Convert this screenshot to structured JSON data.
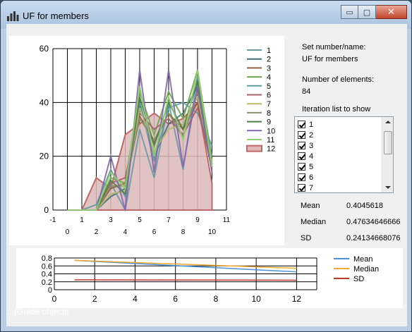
{
  "window": {
    "title": "UF for members",
    "minimize_symbol": "▭",
    "maximize_symbol": "▢",
    "close_symbol": "✕"
  },
  "info": {
    "set_label": "Set number/name:",
    "set_value": "UF for members",
    "elements_label": "Number of elements:",
    "elements_value": "84",
    "iteration_label": "Iteration list to show",
    "iterations": [
      {
        "label": "1",
        "checked": true
      },
      {
        "label": "2",
        "checked": true
      },
      {
        "label": "3",
        "checked": true
      },
      {
        "label": "4",
        "checked": true
      },
      {
        "label": "5",
        "checked": true
      },
      {
        "label": "6",
        "checked": true
      },
      {
        "label": "7",
        "checked": true
      }
    ]
  },
  "stats": {
    "mean_label": "Mean",
    "mean_value": "0.4045618",
    "median_label": "Median",
    "median_value": "0.47634646666",
    "sd_label": "SD",
    "sd_value": "0.24134668076"
  },
  "background_text": "...(Guide objects",
  "chart_data": [
    {
      "type": "line",
      "title": "",
      "xlabel": "",
      "ylabel": "",
      "xlim": [
        -1,
        11
      ],
      "ylim": [
        0,
        60
      ],
      "x_ticks_top": [
        "-1",
        "1",
        "3",
        "5",
        "7",
        "9",
        "11"
      ],
      "x_ticks_bottom": [
        "0",
        "2",
        "4",
        "6",
        "8",
        "10"
      ],
      "y_ticks": [
        "0",
        "20",
        "40",
        "60"
      ],
      "grid": true,
      "legend_position": "right",
      "x": [
        0,
        1,
        2,
        3,
        4,
        5,
        6,
        7,
        8,
        9,
        10
      ],
      "series": [
        {
          "name": "1",
          "color": "#6b9aa6",
          "values": [
            0,
            0,
            0,
            10,
            0,
            30,
            12,
            40,
            15,
            50,
            20
          ]
        },
        {
          "name": "2",
          "color": "#3d6e80",
          "values": [
            0,
            0,
            0,
            5,
            8,
            40,
            20,
            32,
            36,
            46,
            17
          ]
        },
        {
          "name": "3",
          "color": "#8e5f3c",
          "values": [
            0,
            0,
            0,
            8,
            10,
            35,
            25,
            36,
            30,
            40,
            15
          ]
        },
        {
          "name": "4",
          "color": "#6fa84b",
          "values": [
            0,
            0,
            0,
            12,
            10,
            44,
            28,
            44,
            34,
            52,
            18
          ]
        },
        {
          "name": "5",
          "color": "#5c9aa0",
          "values": [
            0,
            0,
            2,
            15,
            5,
            40,
            18,
            38,
            40,
            36,
            24
          ]
        },
        {
          "name": "6",
          "color": "#a8606b",
          "values": [
            0,
            0,
            0,
            10,
            12,
            36,
            30,
            34,
            28,
            38,
            16
          ]
        },
        {
          "name": "7",
          "color": "#b8b86a",
          "values": [
            0,
            0,
            0,
            6,
            7,
            38,
            22,
            30,
            32,
            42,
            18
          ]
        },
        {
          "name": "8",
          "color": "#8c8c68",
          "values": [
            0,
            0,
            0,
            9,
            9,
            34,
            26,
            36,
            27,
            44,
            17
          ]
        },
        {
          "name": "9",
          "color": "#4f7f49",
          "values": [
            0,
            0,
            0,
            11,
            6,
            42,
            24,
            40,
            30,
            48,
            16
          ]
        },
        {
          "name": "10",
          "color": "#8466b0",
          "values": [
            0,
            0,
            0,
            20,
            0,
            52,
            14,
            52,
            16,
            46,
            14
          ]
        },
        {
          "name": "11",
          "color": "#8fcf70",
          "values": [
            0,
            0,
            0,
            14,
            8,
            46,
            20,
            42,
            26,
            52,
            16
          ]
        },
        {
          "name": "12",
          "color": "#c06866",
          "fill": "#dcb8b8",
          "style": "area",
          "values": [
            0,
            0,
            12,
            8,
            28,
            32,
            36,
            32,
            34,
            40,
            10
          ]
        }
      ]
    },
    {
      "type": "line",
      "title": "",
      "xlabel": "",
      "ylabel": "",
      "xlim": [
        0,
        13
      ],
      "ylim": [
        0,
        0.8
      ],
      "x_ticks": [
        "0",
        "2",
        "4",
        "6",
        "8",
        "10",
        "12"
      ],
      "y_ticks": [
        "0",
        "0.2",
        "0.4",
        "0.6",
        "0.8"
      ],
      "grid": true,
      "legend_position": "right",
      "x": [
        1,
        12
      ],
      "series": [
        {
          "name": "Mean",
          "color": "#4a90d9",
          "values": [
            0.74,
            0.45
          ]
        },
        {
          "name": "Median",
          "color": "#f0a830",
          "values": [
            0.74,
            0.54
          ]
        },
        {
          "name": "SD",
          "color": "#c0392b",
          "values": [
            0.25,
            0.24
          ]
        }
      ]
    }
  ]
}
